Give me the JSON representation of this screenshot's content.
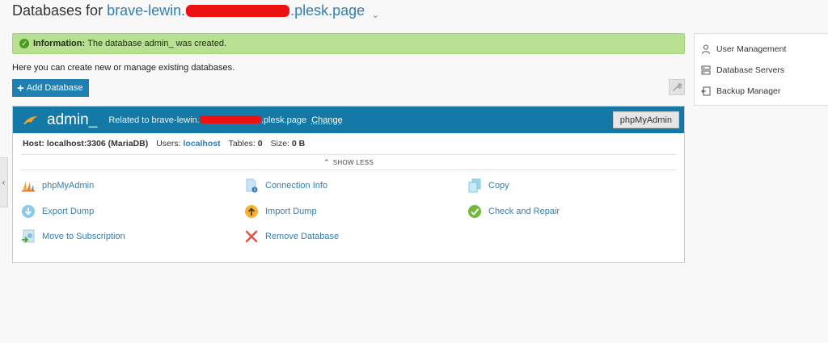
{
  "header": {
    "title_prefix": "Databases for",
    "domain_start": "brave-lewin.",
    "domain_end": ".plesk.page"
  },
  "notice": {
    "label": "Information:",
    "message": "The database admin_ was created."
  },
  "intro": "Here you can create new or manage existing databases.",
  "toolbar": {
    "add_database_label": "Add Database"
  },
  "database": {
    "name": "admin_",
    "related_prefix": "Related to brave-lewin.",
    "related_suffix": ".plesk.page",
    "change_label": "Change",
    "phpmyadmin_button": "phpMyAdmin",
    "host_label": "Host:",
    "host_value": "localhost:3306 (MariaDB)",
    "users_label": "Users:",
    "users_value": "localhost",
    "tables_label": "Tables:",
    "tables_value": "0",
    "size_label": "Size:",
    "size_value": "0 B",
    "show_less": "SHOW LESS",
    "actions": {
      "phpmyadmin": "phpMyAdmin",
      "connection_info": "Connection Info",
      "copy": "Copy",
      "export_dump": "Export Dump",
      "import_dump": "Import Dump",
      "check_repair": "Check and Repair",
      "move_subscription": "Move to Subscription",
      "remove_database": "Remove Database"
    }
  },
  "sidebar": {
    "items": [
      {
        "label": "User Management",
        "icon": "user-icon"
      },
      {
        "label": "Database Servers",
        "icon": "server-icon"
      },
      {
        "label": "Backup Manager",
        "icon": "backup-icon"
      }
    ]
  },
  "colors": {
    "accent": "#1479a6",
    "link": "#2f7fb4",
    "success_bg": "#b7e092"
  }
}
